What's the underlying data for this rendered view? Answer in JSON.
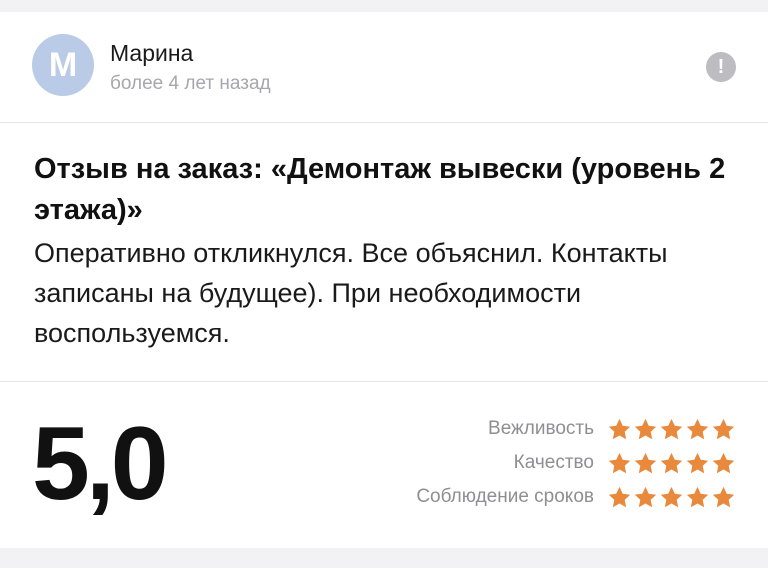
{
  "review": {
    "avatar_letter": "М",
    "author": "Марина",
    "time": "более 4 лет назад",
    "report_symbol": "!",
    "title": "Отзыв на заказ: «Демонтаж вывески (уровень 2 этажа)»",
    "text": "Оперативно откликнулся. Все объяснил. Контакты записаны на будущее). При необходимости воспользуемся.",
    "score": "5,0",
    "ratings": [
      {
        "label": "Вежливость",
        "stars": 5
      },
      {
        "label": "Качество",
        "stars": 5
      },
      {
        "label": "Соблюдение сроков",
        "stars": 5
      }
    ]
  },
  "colors": {
    "star": "#e8893c",
    "avatar": "#b9cbe6"
  },
  "icons": {
    "report": "exclamation-circle-icon",
    "star": "star-icon"
  }
}
